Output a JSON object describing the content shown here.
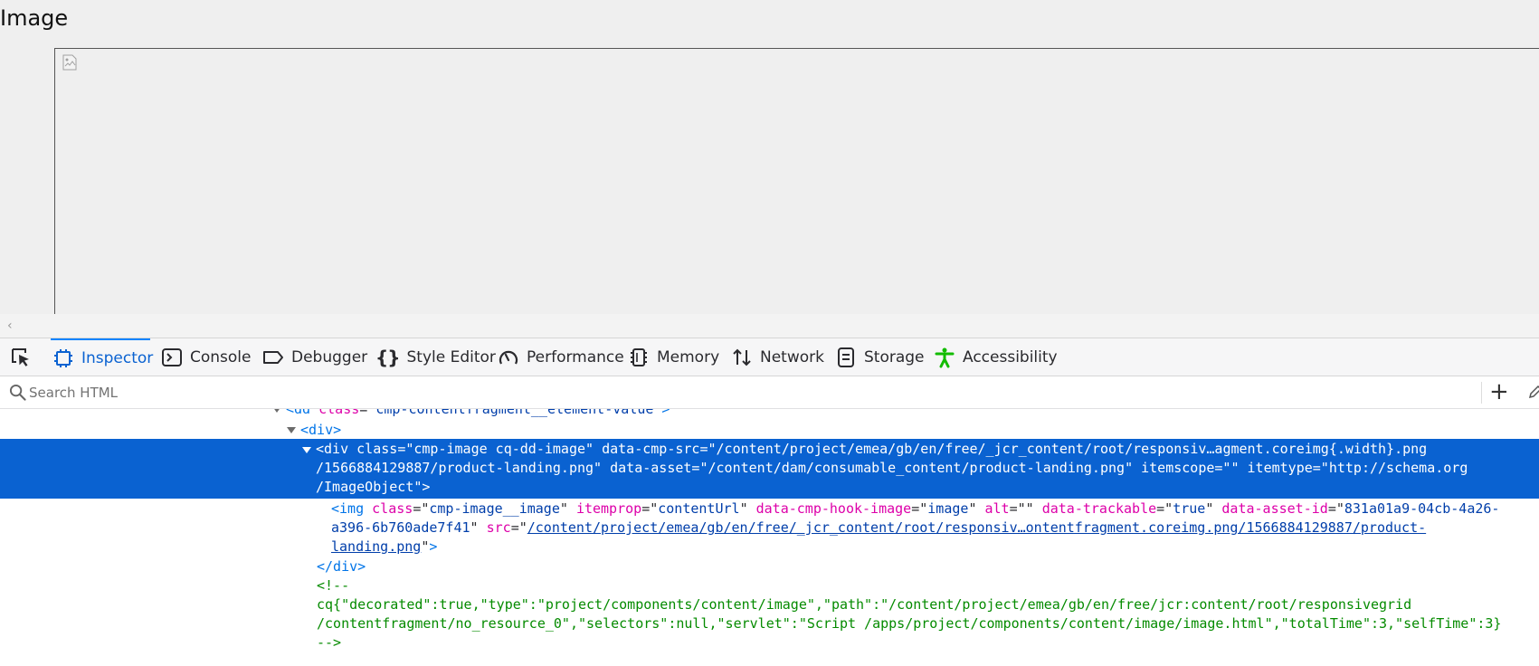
{
  "page": {
    "heading": "Image"
  },
  "devtools": {
    "tabs": [
      {
        "label": "Inspector",
        "icon": "inspector-icon",
        "active": true
      },
      {
        "label": "Console",
        "icon": "console-icon"
      },
      {
        "label": "Debugger",
        "icon": "debugger-icon"
      },
      {
        "label": "Style Editor",
        "icon": "style-editor-icon"
      },
      {
        "label": "Performance",
        "icon": "performance-icon"
      },
      {
        "label": "Memory",
        "icon": "memory-icon"
      },
      {
        "label": "Network",
        "icon": "network-icon"
      },
      {
        "label": "Storage",
        "icon": "storage-icon"
      },
      {
        "label": "Accessibility",
        "icon": "accessibility-icon"
      }
    ],
    "search": {
      "placeholder": "Search HTML",
      "value": ""
    },
    "add_button": "+",
    "accent_color": "#0a62d1",
    "accessibility_color": "#12bc00"
  },
  "tree": {
    "line0": {
      "open": "<",
      "tag": "dd",
      "attr": "class",
      "eq": "=\"",
      "val": "cmp-contentfragment__element-value",
      "close": "\">"
    },
    "line1": {
      "open": "<",
      "tag": "div",
      "close": ">"
    },
    "selected": {
      "l1_open": "<",
      "l1_tag": "div",
      "a1": "class",
      "v1": "cmp-image cq-dd-image",
      "a2": "data-cmp-src",
      "v2a": "/content/project/emea/gb/en/free/_jcr_content/root/responsiv…agment.coreimg{.width}.png",
      "v2b": "/1566884129887/product-landing.png",
      "a3": "data-asset",
      "v3": "/content/dam/consumable_content/product-landing.png",
      "a4": "itemscope",
      "v4": "",
      "a5": "itemtype",
      "v5a": "http://schema.org",
      "v5b": "/ImageObject",
      "close": ">"
    },
    "img": {
      "tag": "img",
      "a1": "class",
      "v1": "cmp-image__image",
      "a2": "itemprop",
      "v2": "contentUrl",
      "a3": "data-cmp-hook-image",
      "v3": "image",
      "a4": "alt",
      "v4": "",
      "a5": "data-trackable",
      "v5": "true",
      "a6": "data-asset-id",
      "v6a": "831a01a9-04cb-4a26-",
      "v6b": "a396-6b760ade7f41",
      "a7": "src",
      "v7a": "/content/project/emea/gb/en/free/_jcr_content/root/responsiv…ontentfragment.coreimg.png/1566884129887/product-",
      "v7b": "landing.png"
    },
    "close_div": "</div>",
    "comment": {
      "l1": "<!--",
      "l2": "cq{\"decorated\":true,\"type\":\"project/components/content/image\",\"path\":\"/content/project/emea/gb/en/free/jcr:content/root/responsivegrid",
      "l3": "/contentfragment/no_resource_0\",\"selectors\":null,\"servlet\":\"Script /apps/project/components/content/image/image.html\",\"totalTime\":3,\"selfTime\":3}",
      "l4": "-->"
    }
  }
}
